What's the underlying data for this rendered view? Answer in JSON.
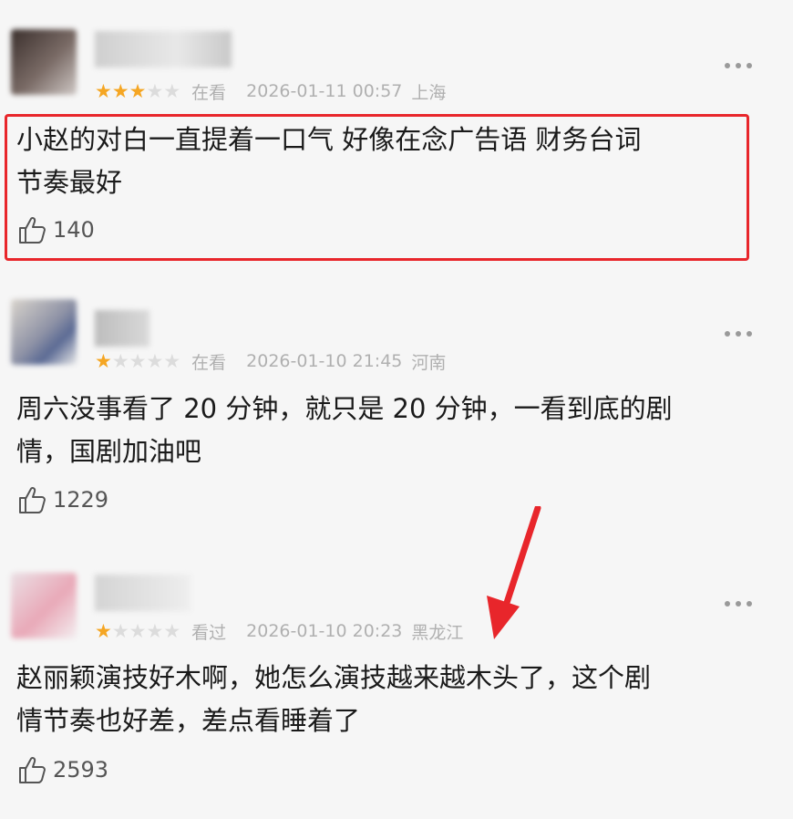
{
  "reviews": [
    {
      "rating": 3,
      "status": "在看",
      "datetime": "2026-01-11 00:57",
      "location": "上海",
      "text_lines": [
        "小赵的对白一直提着一口气 好像在念广告语 财务台词",
        "节奏最好"
      ],
      "likes": "140",
      "icons": [
        "thumbs-up-icon",
        "more-icon"
      ]
    },
    {
      "rating": 1,
      "status": "在看",
      "datetime": "2026-01-10 21:45",
      "location": "河南",
      "text_lines": [
        "周六没事看了 20 分钟，就只是 20 分钟，一看到底的剧",
        "情，国剧加油吧"
      ],
      "likes": "1229",
      "icons": [
        "thumbs-up-icon",
        "more-icon"
      ]
    },
    {
      "rating": 1,
      "status": "看过",
      "datetime": "2026-01-10 20:23",
      "location": "黑龙江",
      "text_lines": [
        "赵丽颖演技好木啊，她怎么演技越来越木头了，这个剧",
        "情节奏也好差，差点看睡着了"
      ],
      "likes": "2593",
      "icons": [
        "thumbs-up-icon",
        "more-icon"
      ]
    }
  ],
  "colors": {
    "star_on": "#f5a623",
    "highlight_border": "#e8262b",
    "annotation_arrow": "#e8262b"
  }
}
